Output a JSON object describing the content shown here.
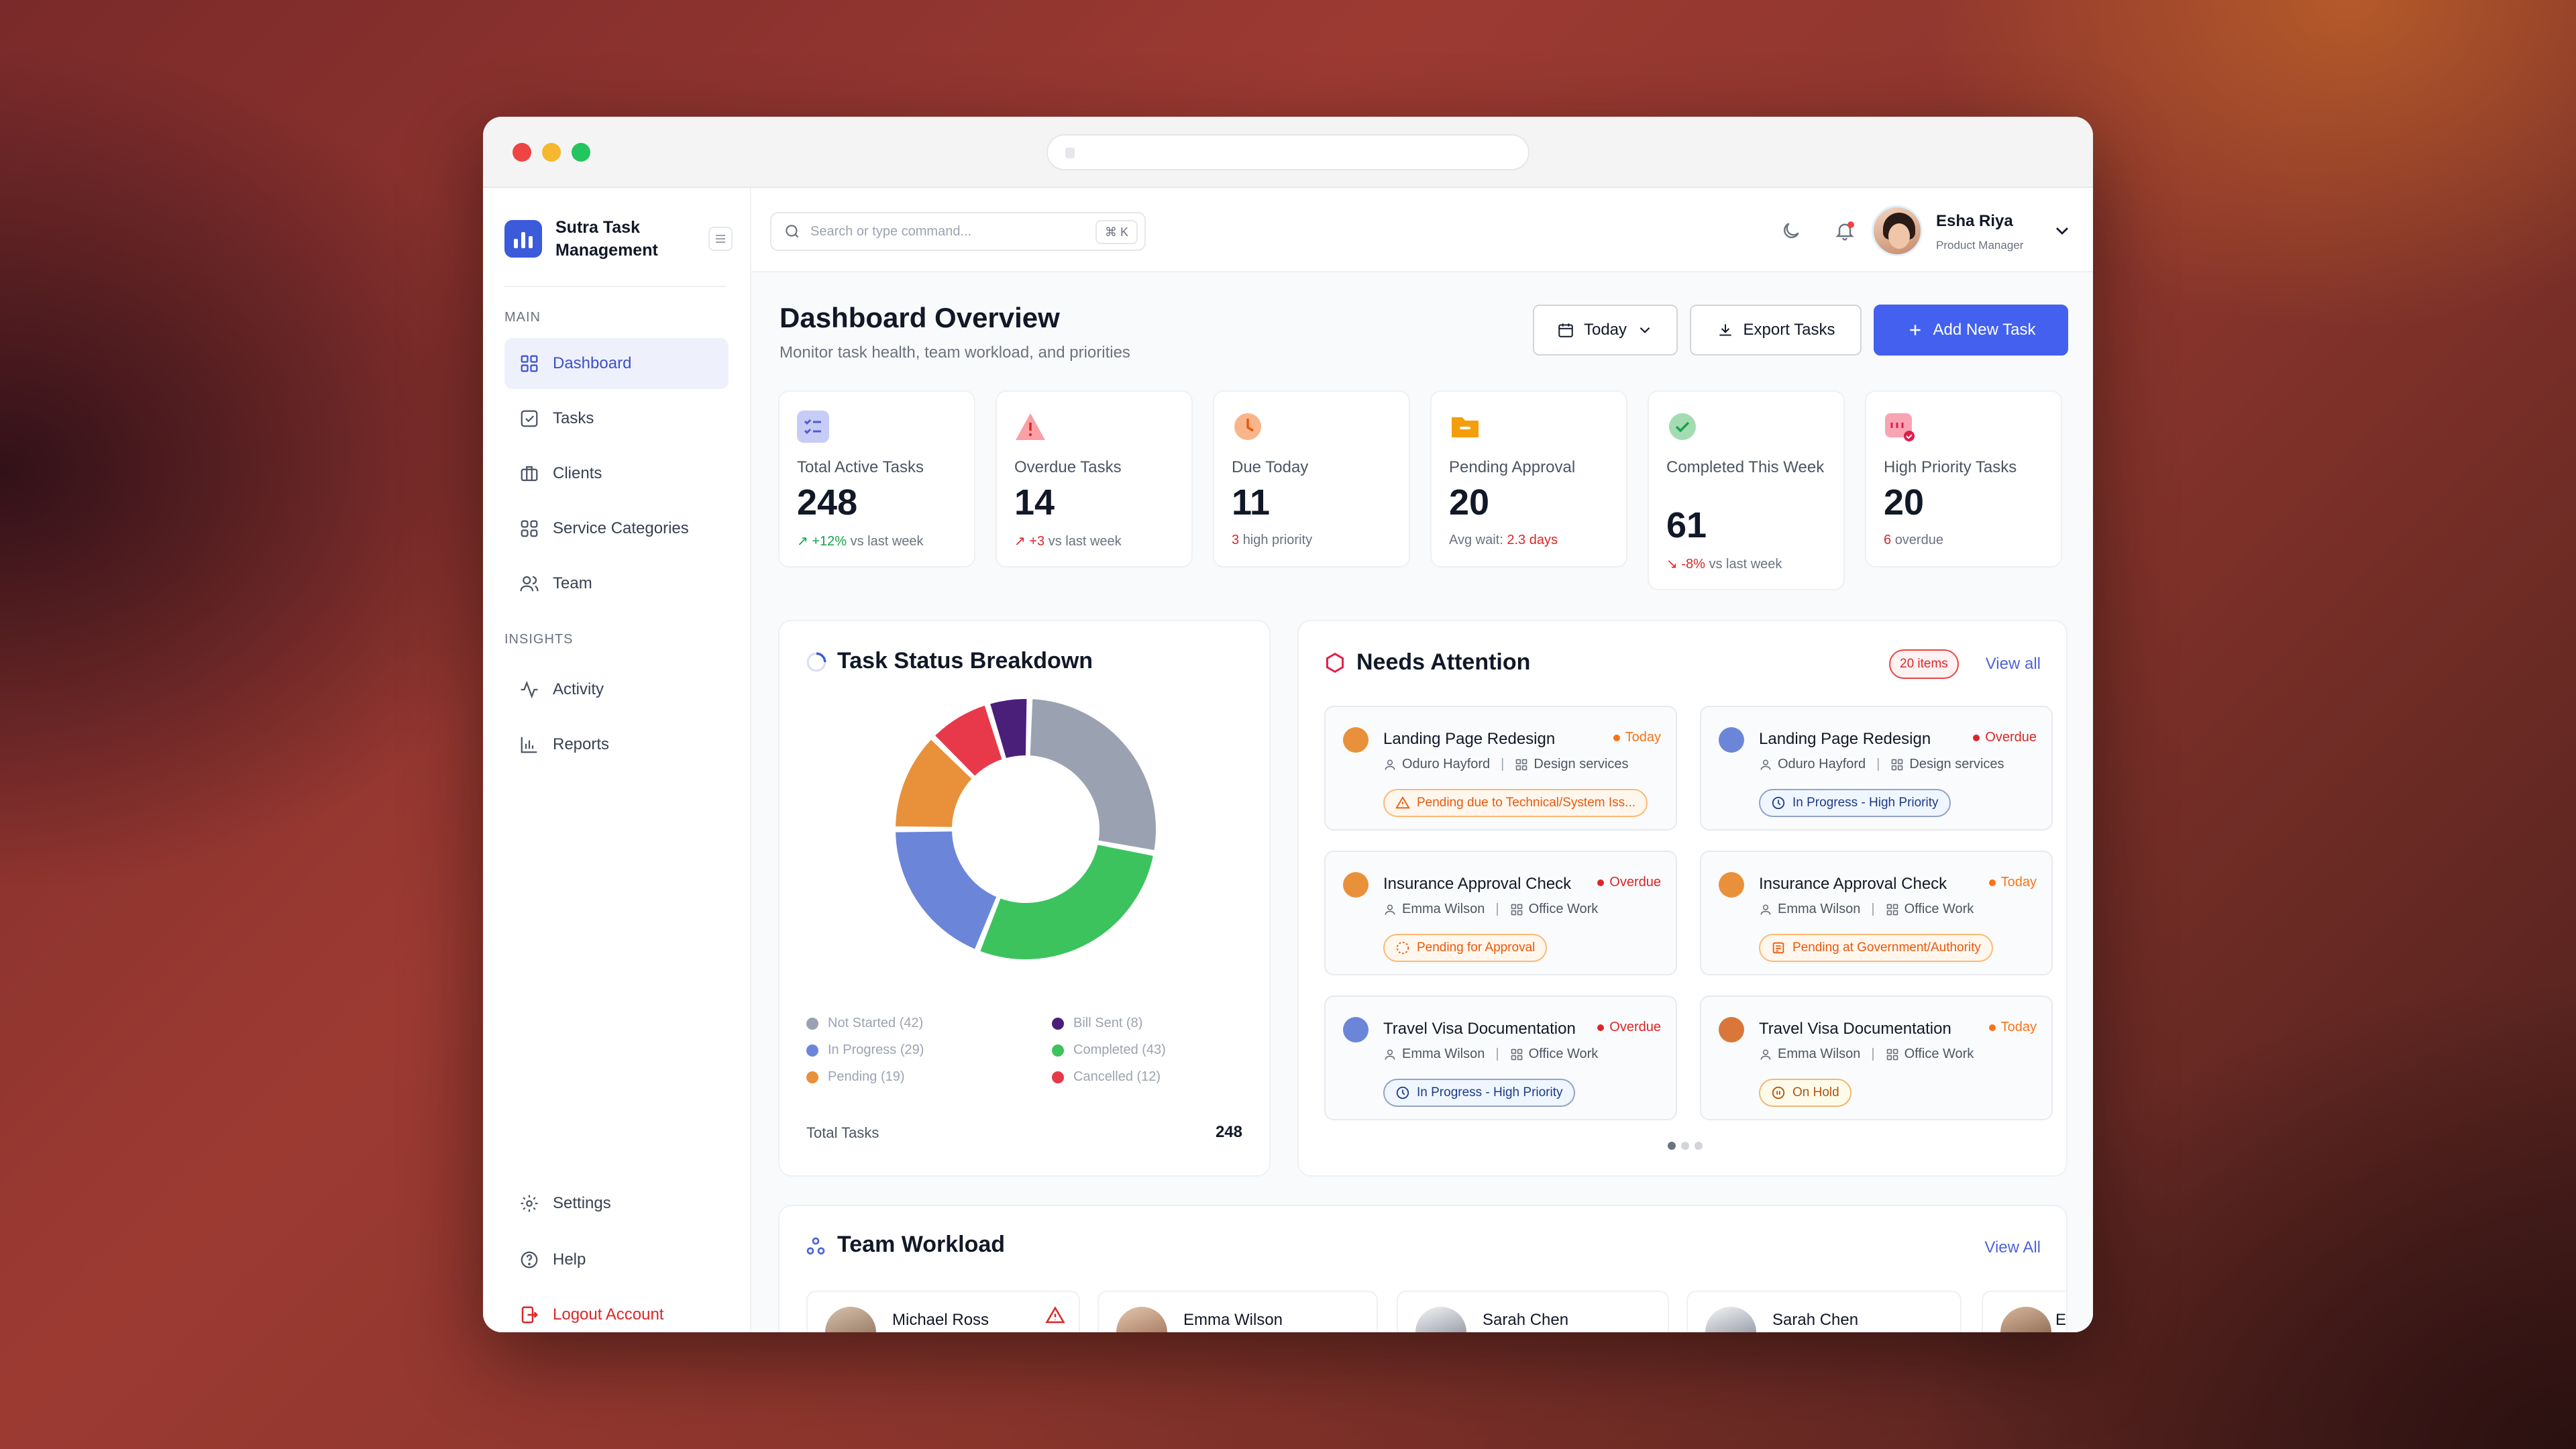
{
  "brand": {
    "name": "Sutra Task Management"
  },
  "nav": {
    "main_label": "MAIN",
    "insights_label": "INSIGHTS",
    "items": [
      {
        "label": "Dashboard"
      },
      {
        "label": "Tasks"
      },
      {
        "label": "Clients"
      },
      {
        "label": "Service Categories"
      },
      {
        "label": "Team"
      },
      {
        "label": "Activity"
      },
      {
        "label": "Reports"
      }
    ],
    "settings": "Settings",
    "help": "Help",
    "logout": "Logout Account"
  },
  "topbar": {
    "search_placeholder": "Search or type command...",
    "shortcut": "⌘ K",
    "user_name": "Esha Riya",
    "user_role": "Product Manager"
  },
  "header": {
    "title": "Dashboard Overview",
    "subtitle": "Monitor task health, team workload, and priorities",
    "today_label": "Today",
    "export_label": "Export Tasks",
    "add_label": "Add New Task"
  },
  "stats": [
    {
      "label": "Total Active Tasks",
      "value": "248",
      "trend": "+12%",
      "suffix": "vs last week",
      "color": "#7c83e6"
    },
    {
      "label": "Overdue Tasks",
      "value": "14",
      "trend": "+3",
      "suffix": "vs last week",
      "color": "#ef4444"
    },
    {
      "label": "Due Today",
      "value": "11",
      "trend": "3",
      "suffix": "high priority",
      "color": "#f97316"
    },
    {
      "label": "Pending Approval",
      "value": "20",
      "prefix": "Avg wait:",
      "trend": "2.3 days",
      "color": "#f59e0b"
    },
    {
      "label": "Completed This Week",
      "value": "61",
      "trend": "-8%",
      "suffix": "vs last week",
      "color": "#22c55e"
    },
    {
      "label": "High Priority Tasks",
      "value": "20",
      "trend": "6",
      "suffix": "overdue",
      "color": "#f43f5e"
    }
  ],
  "breakdown": {
    "title": "Task Status Breakdown",
    "total_label": "Total Tasks",
    "total_value": "248"
  },
  "chart_data": {
    "type": "pie",
    "categories": [
      "Not Started",
      "Completed",
      "In Progress",
      "Pending",
      "Cancelled",
      "Bill Sent"
    ],
    "values": [
      42,
      43,
      29,
      19,
      12,
      8
    ],
    "colors": [
      "#9aa2b1",
      "#3cc35e",
      "#6b86d9",
      "#e8913a",
      "#e8394a",
      "#4a1f7a"
    ],
    "legend": [
      {
        "label": "Not Started (42)",
        "color": "#9aa2b1"
      },
      {
        "label": "In Progress (29)",
        "color": "#6b86d9"
      },
      {
        "label": "Pending (19)",
        "color": "#e8913a"
      },
      {
        "label": "Bill Sent (8)",
        "color": "#4a1f7a"
      },
      {
        "label": "Completed (43)",
        "color": "#3cc35e"
      },
      {
        "label": "Cancelled (12)",
        "color": "#e8394a"
      }
    ]
  },
  "attention": {
    "title": "Needs Attention",
    "count": "20 items",
    "view_all": "View all",
    "items": [
      {
        "title": "Landing Page Redesign",
        "due": "Today",
        "due_color": "#f97316",
        "person": "Oduro Hayford",
        "category": "Design services",
        "status": "Pending due to Technical/System Iss...",
        "dot": "#e8913a"
      },
      {
        "title": "Landing Page Redesign",
        "due": "Overdue",
        "due_color": "#dc2626",
        "person": "Oduro Hayford",
        "category": "Design services",
        "status": "In Progress - High Priority",
        "dot": "#6b86d9"
      },
      {
        "title": "Insurance Approval Check",
        "due": "Overdue",
        "due_color": "#dc2626",
        "person": "Emma Wilson",
        "category": "Office Work",
        "status": "Pending for Approval",
        "dot": "#e8913a"
      },
      {
        "title": "Insurance Approval Check",
        "due": "Today",
        "due_color": "#f97316",
        "person": "Emma Wilson",
        "category": "Office Work",
        "status": "Pending at Government/Authority",
        "dot": "#e8913a"
      },
      {
        "title": "Travel Visa Documentation",
        "due": "Overdue",
        "due_color": "#dc2626",
        "person": "Emma Wilson",
        "category": "Office Work",
        "status": "In Progress - High Priority",
        "dot": "#6b86d9"
      },
      {
        "title": "Travel Visa Documentation",
        "due": "Today",
        "due_color": "#f97316",
        "person": "Emma Wilson",
        "category": "Office Work",
        "status": "On Hold",
        "dot": "#d9773a"
      }
    ]
  },
  "workload": {
    "title": "Team Workload",
    "view_all": "View All",
    "members": [
      {
        "name": "Michael Ross"
      },
      {
        "name": "Emma Wilson"
      },
      {
        "name": "Sarah Chen"
      },
      {
        "name": "Sarah Chen"
      },
      {
        "name": "E"
      }
    ]
  }
}
